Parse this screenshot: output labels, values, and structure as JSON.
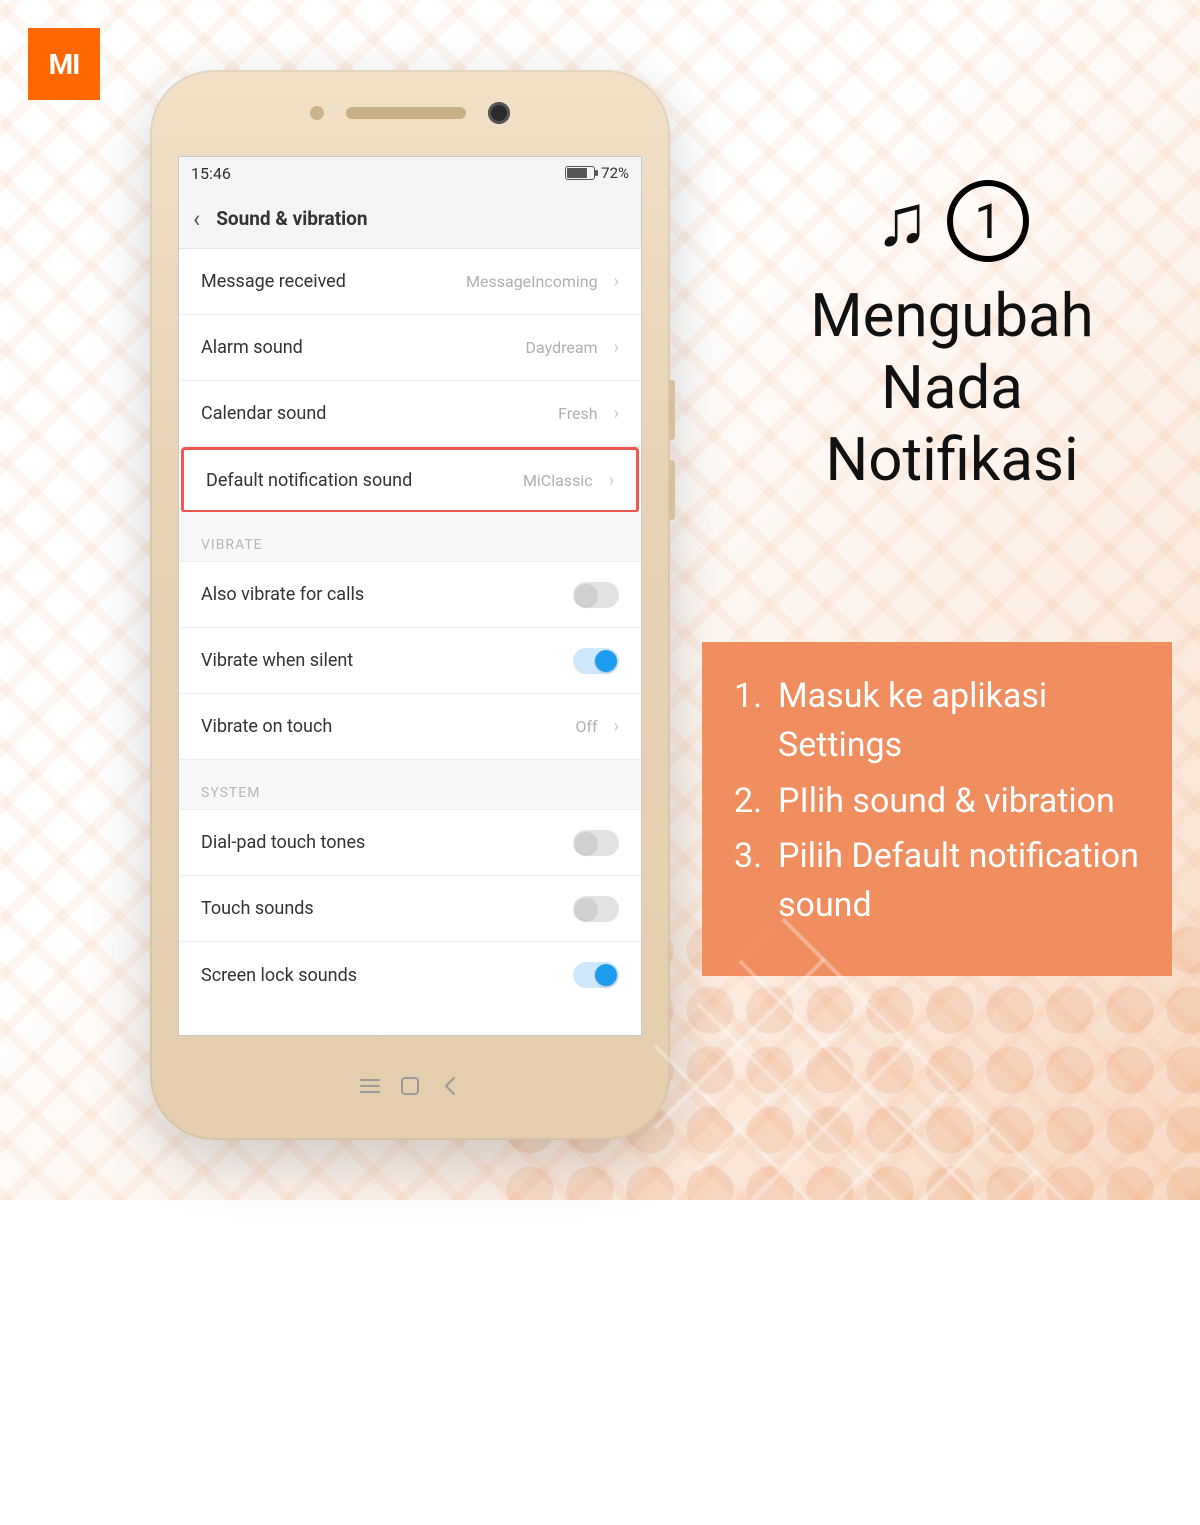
{
  "logo_text": "MI",
  "statusbar": {
    "time": "15:46",
    "battery_pct": "72%"
  },
  "titlebar": {
    "title": "Sound & vibration"
  },
  "rows": [
    {
      "label": "Message received",
      "value": "MessageIncoming",
      "type": "nav",
      "highlight": false
    },
    {
      "label": "Alarm sound",
      "value": "Daydream",
      "type": "nav",
      "highlight": false
    },
    {
      "label": "Calendar sound",
      "value": "Fresh",
      "type": "nav",
      "highlight": false
    },
    {
      "label": "Default notification sound",
      "value": "MiClassic",
      "type": "nav",
      "highlight": true
    }
  ],
  "section_vibrate": "VIBRATE",
  "vibrate_rows": [
    {
      "label": "Also vibrate for calls",
      "type": "toggle",
      "on": false
    },
    {
      "label": "Vibrate when silent",
      "type": "toggle",
      "on": true
    },
    {
      "label": "Vibrate on touch",
      "type": "nav",
      "value": "Off"
    }
  ],
  "section_system": "SYSTEM",
  "system_rows": [
    {
      "label": "Dial-pad touch tones",
      "type": "toggle",
      "on": false
    },
    {
      "label": "Touch sounds",
      "type": "toggle",
      "on": false
    },
    {
      "label": "Screen lock sounds",
      "type": "toggle",
      "on": true
    }
  ],
  "side": {
    "step_number": "1",
    "heading_line1": "Mengubah",
    "heading_line2": "Nada",
    "heading_line3": "Notifikasi"
  },
  "instructions": [
    {
      "n": "1.",
      "text": "Masuk ke aplikasi Settings"
    },
    {
      "n": "2.",
      "text": "PIlih sound & vibration"
    },
    {
      "n": "3.",
      "text": "Pilih Default notification sound"
    }
  ]
}
